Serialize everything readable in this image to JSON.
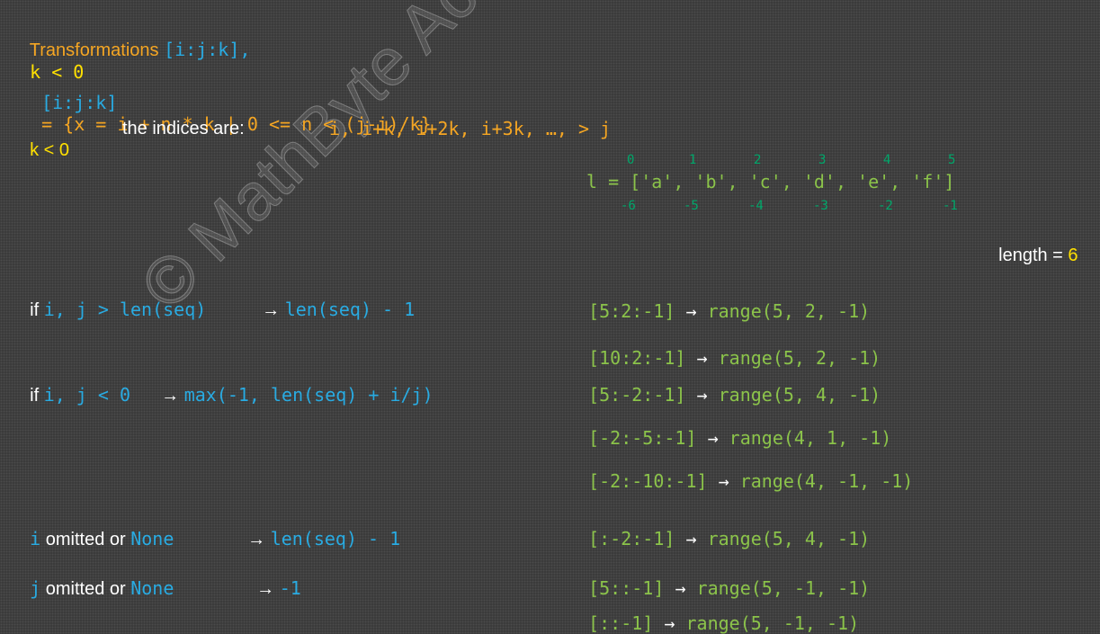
{
  "title": {
    "label": "Transformations ",
    "code": "[i:j:k],",
    "cond": "k < 0"
  },
  "definition": {
    "lhs": "[i:j:k]",
    "rhs": "= {x = i + n * k | 0 <= n < (j-i)/k}"
  },
  "indices_line": {
    "k_label": "k < 0",
    "text": "the indices are:",
    "seq": "i, i+k, i+2k, i+3k, …, > j"
  },
  "list": {
    "expr": "l = ['a', 'b', 'c', 'd', 'e', 'f']",
    "pos_indices": [
      "0",
      "1",
      "2",
      "3",
      "4",
      "5"
    ],
    "neg_indices": [
      "-6",
      "-5",
      "-4",
      "-3",
      "-2",
      "-1"
    ],
    "length_label": "length = ",
    "length_value": "6"
  },
  "rules": [
    {
      "prefix": "if ",
      "cond": "i, j > len(seq)",
      "arrow": "→",
      "result": "len(seq) - 1"
    },
    {
      "prefix": "if ",
      "cond": "i, j < 0",
      "arrow": "→",
      "result": "max(-1, len(seq) + i/j)"
    },
    {
      "var": "i",
      "mid": " omitted or ",
      "none": "None",
      "arrow": "→",
      "result": "len(seq) - 1"
    },
    {
      "var": "j",
      "mid": " omitted or ",
      "none": "None",
      "arrow": "→",
      "result": "-1"
    }
  ],
  "examples": [
    {
      "slice": "[5:2:-1]",
      "arrow": "→",
      "range": "range(5, 2, -1)"
    },
    {
      "slice": "[10:2:-1]",
      "arrow": "→",
      "range": "range(5, 2, -1)"
    },
    {
      "slice": "[5:-2:-1]",
      "arrow": "→",
      "range": "range(5, 4, -1)"
    },
    {
      "slice": "[-2:-5:-1]",
      "arrow": "→",
      "range": "range(4, 1, -1)"
    },
    {
      "slice": "[-2:-10:-1]",
      "arrow": "→",
      "range": "range(4, -1, -1)"
    },
    {
      "slice": "[:-2:-1]",
      "arrow": "→",
      "range": "range(5, 4, -1)"
    },
    {
      "slice": "[5::-1]",
      "arrow": "→",
      "range": "range(5, -1, -1)"
    },
    {
      "slice": "[::-1]",
      "arrow": "→",
      "range": "range(5, -1, -1)"
    }
  ],
  "watermark": "© MathByte Academy"
}
